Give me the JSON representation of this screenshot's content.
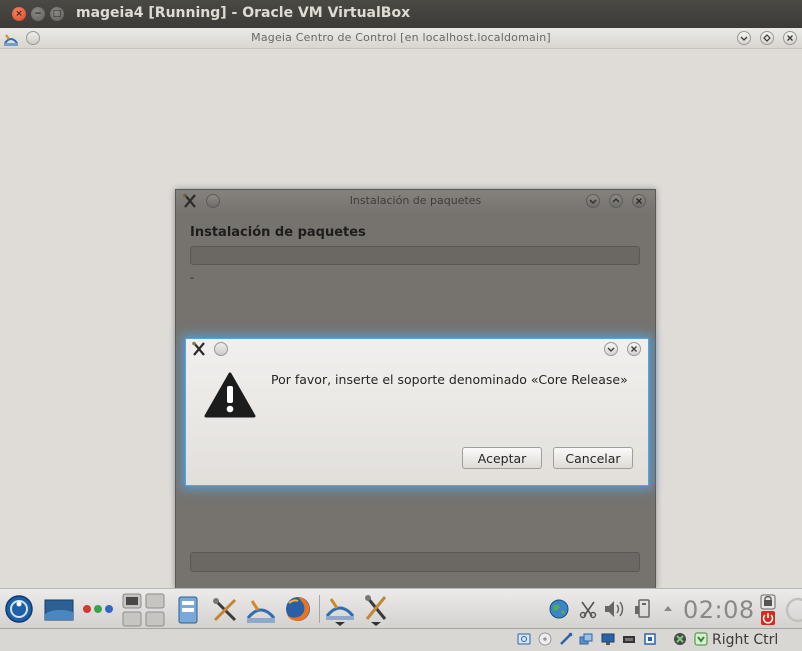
{
  "host": {
    "title": "mageia4 [Running] - Oracle VM VirtualBox",
    "close_glyph": "×",
    "min_glyph": "−",
    "max_glyph": "□"
  },
  "mcc": {
    "title": "Mageia Centro de Control  [en localhost.localdomain]"
  },
  "install_window": {
    "title": "Instalación de paquetes",
    "heading": "Instalación de paquetes",
    "status": "-"
  },
  "dialog": {
    "message": "Por favor, inserte el soporte denominado «Core Release»",
    "ok_label": "Aceptar",
    "cancel_label": "Cancelar"
  },
  "taskbar": {
    "clock": "02:08"
  },
  "vbox_status": {
    "host_key": "Right Ctrl"
  },
  "colors": {
    "host_titlebar": "#3c3b37",
    "guest_bg": "#dfdcd8",
    "dialog_glow": "#4fa8e6",
    "dimmed_window": "#76736f"
  }
}
